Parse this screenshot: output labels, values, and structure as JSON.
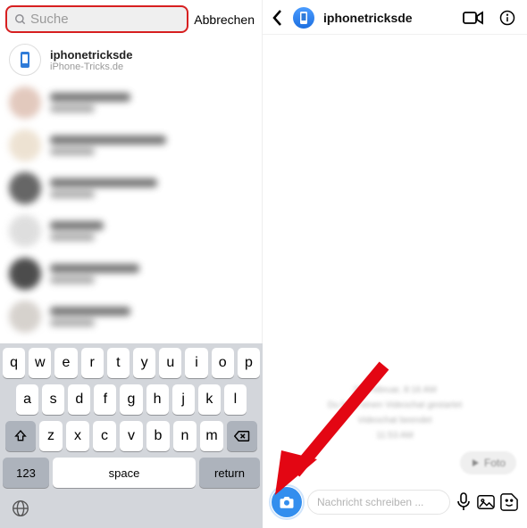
{
  "left": {
    "search": {
      "placeholder": "Suche"
    },
    "cancel": "Abbrechen",
    "top_contact": {
      "name": "iphonetricksde",
      "sub": "iPhone-Tricks.de"
    }
  },
  "keyboard": {
    "row1": [
      "q",
      "w",
      "e",
      "r",
      "t",
      "y",
      "u",
      "i",
      "o",
      "p"
    ],
    "row2": [
      "a",
      "s",
      "d",
      "f",
      "g",
      "h",
      "j",
      "k",
      "l"
    ],
    "row3": [
      "z",
      "x",
      "c",
      "v",
      "b",
      "n",
      "m"
    ],
    "numbers": "123",
    "space": "space",
    "return": "return"
  },
  "right": {
    "title": "iphonetricksde",
    "timestamp1": "26. Februar, 8:16 AM",
    "sys1": "Du hast einen Videochat gestartet",
    "sys2": "Videochat beendet",
    "timestamp2": "11:53 AM",
    "foto": "Foto",
    "composer_placeholder": "Nachricht schreiben ..."
  }
}
